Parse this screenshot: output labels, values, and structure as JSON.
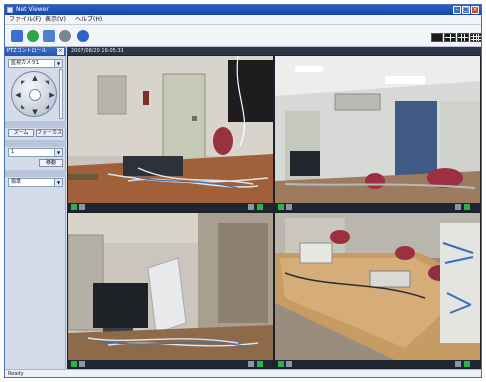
{
  "window": {
    "title": "Net Viewer"
  },
  "menu": {
    "items": [
      "ファイル(F)",
      "表示(V)",
      "ヘルプ(H)"
    ]
  },
  "toolbar": {
    "tools": [
      {
        "icon": "monitor-icon",
        "color": "#3b6fd6"
      },
      {
        "icon": "record-icon",
        "color": "#2da64a"
      },
      {
        "icon": "settings-icon",
        "color": "#4f7fd0"
      },
      {
        "icon": "network-icon",
        "color": "#7a8594"
      },
      {
        "icon": "info-icon",
        "color": "#2f62c9"
      }
    ],
    "layouts": [
      "layout-1x1-icon",
      "layout-2x2-icon",
      "layout-3x3-icon",
      "layout-4x4-icon"
    ]
  },
  "left_panel": {
    "header": "PTZコントロール",
    "camera_select": "監視カメラ1",
    "preset_section": "",
    "preset_buttons": [
      "ズーム",
      "フォーカス"
    ],
    "preset_select": "1",
    "go_button": "移動",
    "option_section": "",
    "option_select": "標準"
  },
  "main": {
    "header": "2007/08/20 16:05:31",
    "cameras": [
      {
        "name": "camera-1"
      },
      {
        "name": "camera-2"
      },
      {
        "name": "camera-3"
      },
      {
        "name": "camera-4"
      }
    ]
  },
  "status": {
    "text": "Ready"
  }
}
